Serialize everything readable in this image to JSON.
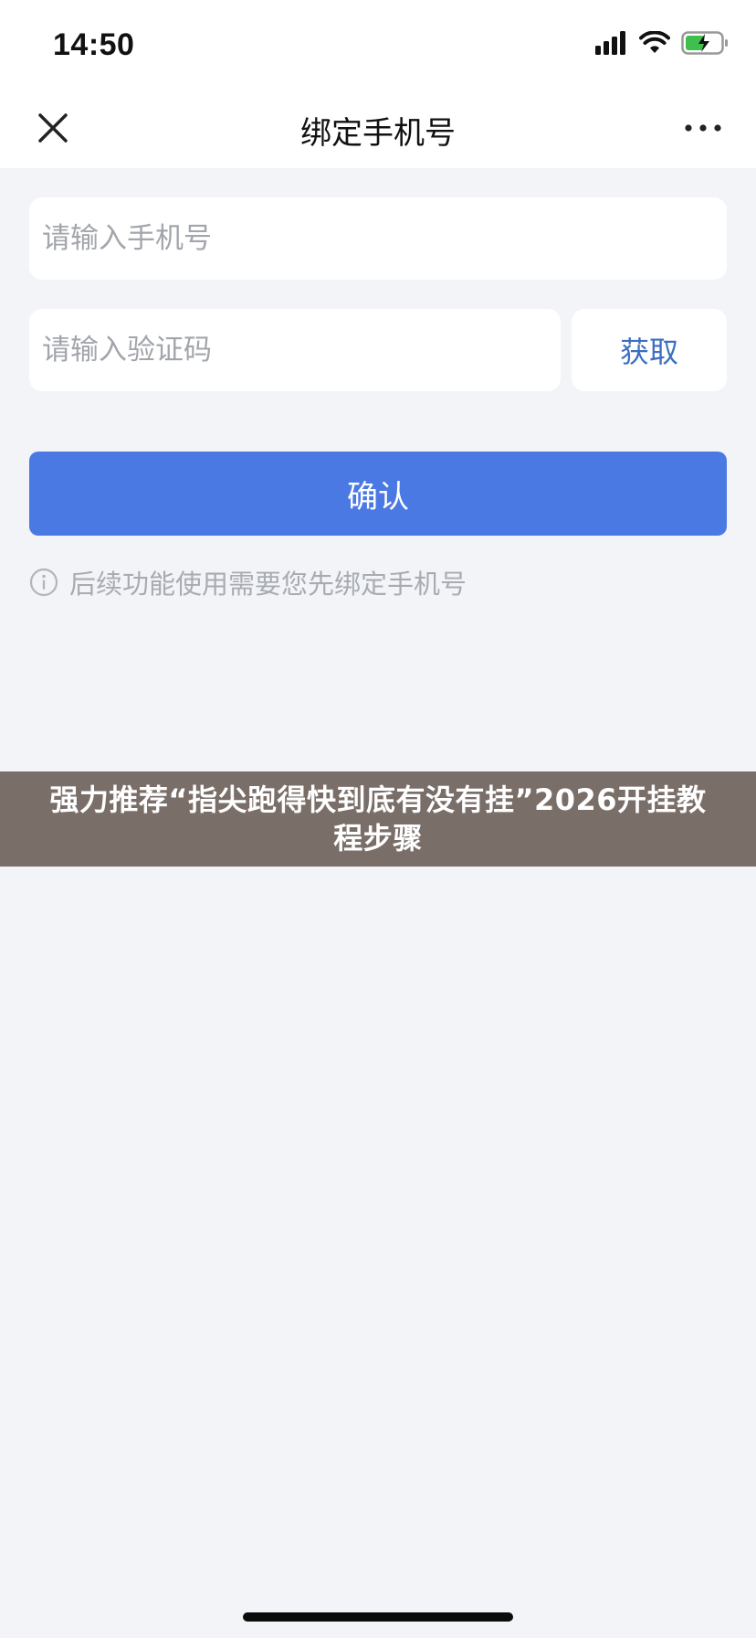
{
  "status_bar": {
    "time": "14:50",
    "signal_icon": "signal-bars-icon",
    "wifi_icon": "wifi-icon",
    "battery_icon": "battery-charging-icon"
  },
  "nav": {
    "title": "绑定手机号",
    "close_icon": "close-icon",
    "more_icon": "more-dots-icon"
  },
  "form": {
    "phone_placeholder": "请输入手机号",
    "phone_value": "",
    "code_placeholder": "请输入验证码",
    "code_value": "",
    "get_code_label": "获取",
    "confirm_label": "确认",
    "hint_text": "后续功能使用需要您先绑定手机号",
    "hint_icon": "info-circle-icon"
  },
  "overlay": {
    "banner_text": "强力推荐“指尖跑得快到底有没有挂”2026开挂教程步骤"
  },
  "colors": {
    "primary": "#4b79e4",
    "link": "#3d6ec2",
    "background": "#f2f4f7",
    "banner": "#7a6e69"
  }
}
